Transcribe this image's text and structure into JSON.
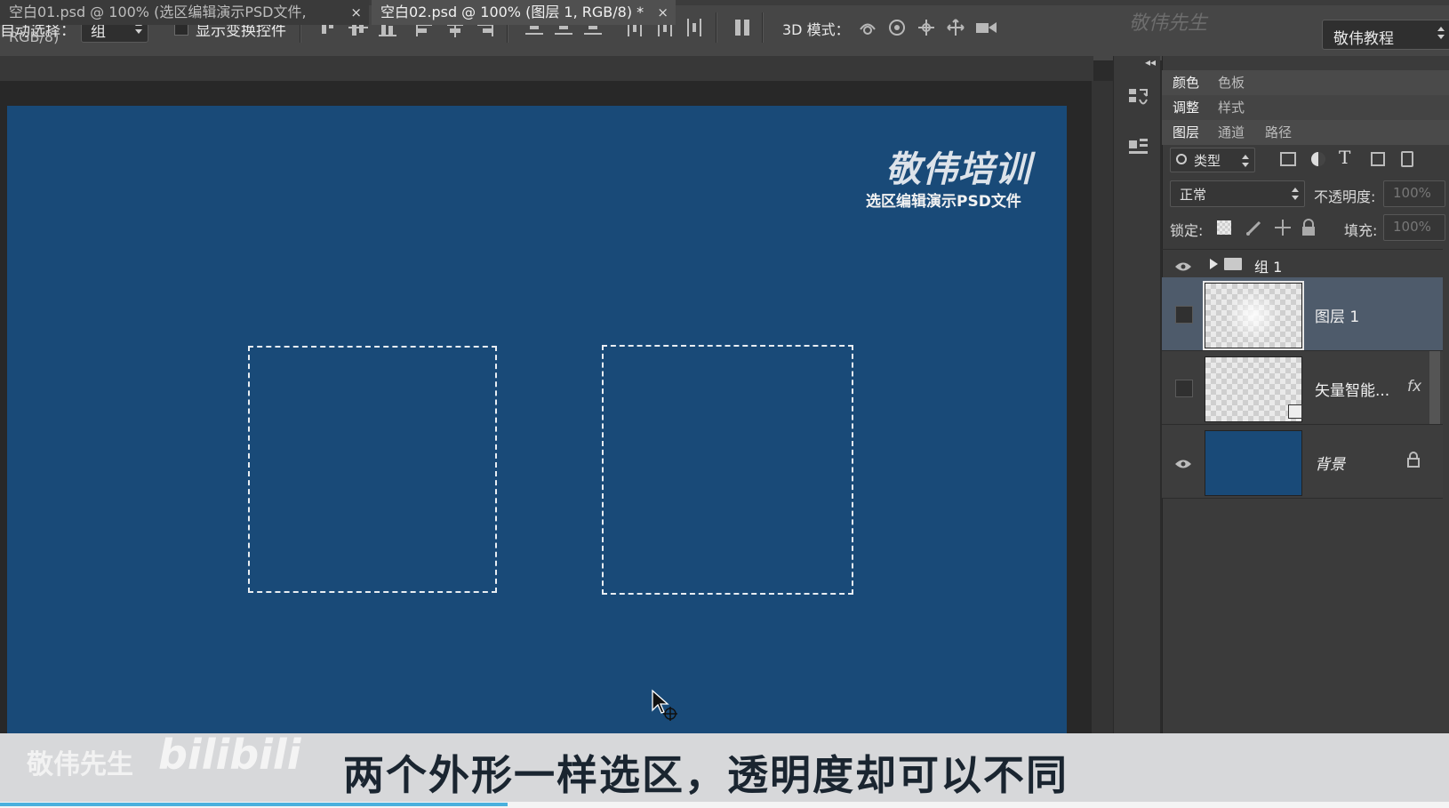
{
  "options_bar": {
    "auto_select_label": "自动选择：",
    "auto_select_value": "组",
    "show_transform_label": "显示变换控件",
    "mode_3d_label": "3D 模式：",
    "workspace_value": "敬伟教程",
    "watermark": "敬伟先生"
  },
  "tabs": [
    {
      "label": "空白01.psd @ 100% (选区编辑演示PSD文件, RGB/8)",
      "close": "×"
    },
    {
      "label": "空白02.psd @ 100% (图层 1, RGB/8) *",
      "close": "×"
    }
  ],
  "canvas": {
    "logo_brand": "敬伟培训",
    "logo_sub": "选区编辑演示PSD文件",
    "bg_color": "#194a78"
  },
  "panels": {
    "row1": [
      "颜色",
      "色板"
    ],
    "row2": [
      "调整",
      "样式"
    ],
    "row3": [
      "图层",
      "通道",
      "路径"
    ],
    "filter_kind": "类型",
    "blend_mode": "正常",
    "opacity_label": "不透明度:",
    "opacity_value": "100%",
    "lock_label": "锁定:",
    "fill_label": "填充:",
    "fill_value": "100%",
    "group_name": "组 1",
    "layers": [
      {
        "name": "图层 1",
        "selected": true
      },
      {
        "name": "矢量智能...",
        "fx": "fx"
      },
      {
        "name": "背景"
      }
    ]
  },
  "subtitle": {
    "brand": "敬伟先生",
    "bili": "bilibili",
    "text": "两个外形一样选区，透明度却可以不同"
  },
  "video_progress": 0.35
}
